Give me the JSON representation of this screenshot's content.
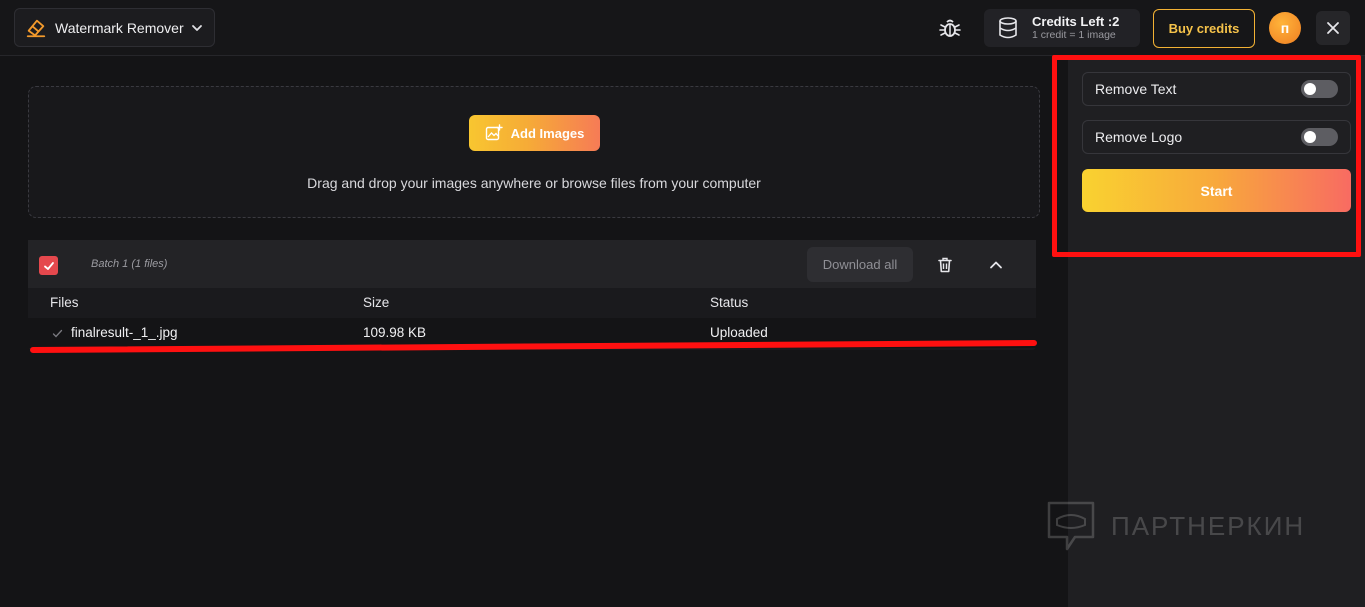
{
  "header": {
    "app_name": "Watermark Remover",
    "credits_main": "Credits Left :2",
    "credits_sub": "1 credit = 1 image",
    "buy_label": "Buy credits",
    "avatar_initial": "п"
  },
  "upload": {
    "add_label": "Add Images",
    "hint": "Drag and drop your images anywhere or browse files from your computer"
  },
  "batch": {
    "label": "Batch 1 (1 files)",
    "download_label": "Download all",
    "columns": [
      "Files",
      "Size",
      "Status"
    ],
    "rows": [
      {
        "file": "finalresult-_1_.jpg",
        "size": "109.98 KB",
        "status": "Uploaded"
      }
    ]
  },
  "options": {
    "remove_text_label": "Remove Text",
    "remove_text_on": false,
    "remove_logo_label": "Remove Logo",
    "remove_logo_on": false,
    "start_label": "Start"
  },
  "watermark_text": "ПАРТНЕРКИН",
  "colors": {
    "accent_yellow": "#f8c630",
    "accent_orange": "#f67b56",
    "annotation_red": "#ff1010",
    "checkbox_red": "#e5484d"
  }
}
